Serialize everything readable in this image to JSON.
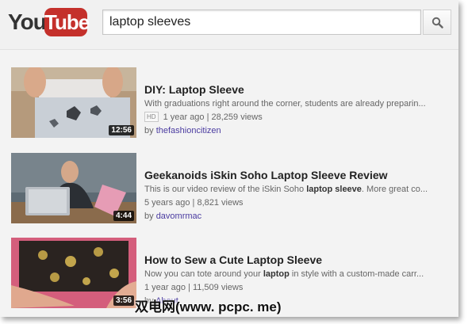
{
  "header": {
    "logo_you": "You",
    "logo_tube": "Tube",
    "search_value": "laptop sleeves"
  },
  "results": [
    {
      "title": "DIY: Laptop Sleeve",
      "desc": "With graduations right around the corner, students are already preparin...",
      "hd_badge": "HD",
      "meta": "1 year ago | 28,259 views",
      "by": "by ",
      "channel": "thefashioncitizen",
      "duration": "12:56"
    },
    {
      "title": "Geekanoids iSkin Soho Laptop Sleeve Review",
      "desc_pre": "This is our video review of the iSkin Soho ",
      "desc_bold": "laptop sleeve",
      "desc_post": ". More great co...",
      "meta": "5 years ago | 8,821 views",
      "by": "by ",
      "channel": "davomrmac",
      "duration": "4:44"
    },
    {
      "title": "How to Sew a Cute Laptop Sleeve",
      "desc_pre": "Now you can tote around your ",
      "desc_bold": "laptop",
      "desc_post": " in style with a custom-made carr...",
      "meta": "1 year ago | 11,509 views",
      "by": "by ",
      "channel": "About",
      "duration": "3:56"
    }
  ],
  "watermark": "双电网(www. pcpc. me)",
  "colors": {
    "brand_red": "#c4302b",
    "channel_link": "#4a3ba0",
    "title": "#222222"
  }
}
